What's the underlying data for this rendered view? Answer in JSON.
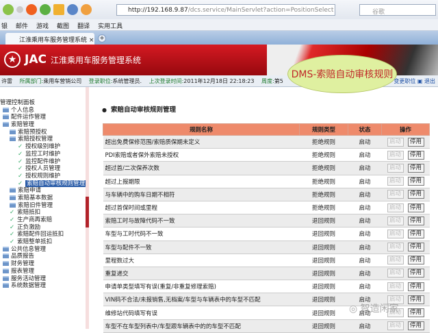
{
  "browser": {
    "url_host": "http://192.168.9.87",
    "url_path": "/dcs.service/MainServlet?action=PositionSelect",
    "search_placeholder": "谷歌",
    "bookmarks": [
      "银",
      "邮件",
      "游戏",
      "截图",
      "翻译",
      "实用工具"
    ],
    "tab_title": "江淮乘用车服务管理系统",
    "new_tab": "+"
  },
  "banner": {
    "brand": "JAC",
    "system": "江淮乘用车服务管理系统",
    "overlay": "DMS-索赔自动审核规则"
  },
  "info": {
    "user": "许雷",
    "dept_label": "所属部门:",
    "dept": "乘用车营销公司",
    "role_label": "登录职位:",
    "role": "系统管理员.",
    "last_label": "上次登录时间:",
    "last": "2011年12月18日 22:18:23",
    "week_label": "周度:",
    "week": "第5",
    "change_role": "变更职位",
    "logout": "退出"
  },
  "sidebar": {
    "title": "管理控制面板",
    "items": [
      {
        "label": "个人信息",
        "level": 0,
        "type": "folder"
      },
      {
        "label": "配件运作管理",
        "level": 0,
        "type": "folder"
      },
      {
        "label": "索赔管理",
        "level": 0,
        "type": "folder"
      },
      {
        "label": "索赔预授权",
        "level": 1,
        "type": "folder"
      },
      {
        "label": "索赔授权管理",
        "level": 1,
        "type": "folder"
      },
      {
        "label": "授权级别维护",
        "level": 2,
        "type": "leaf"
      },
      {
        "label": "监控工时维护",
        "level": 2,
        "type": "leaf"
      },
      {
        "label": "监控配件维护",
        "level": 2,
        "type": "leaf"
      },
      {
        "label": "授权人员管理",
        "level": 2,
        "type": "leaf"
      },
      {
        "label": "授权规则维护",
        "level": 2,
        "type": "leaf"
      },
      {
        "label": "索赔自动审核规则管理",
        "level": 2,
        "type": "leaf",
        "selected": true
      },
      {
        "label": "索赔申请",
        "level": 1,
        "type": "folder"
      },
      {
        "label": "索赔基本数据",
        "level": 1,
        "type": "folder"
      },
      {
        "label": "索赔旧件管理",
        "level": 1,
        "type": "folder"
      },
      {
        "label": "索赔抵扣",
        "level": 1,
        "type": "leaf"
      },
      {
        "label": "生产商再索赔",
        "level": 1,
        "type": "leaf"
      },
      {
        "label": "正负激励",
        "level": 1,
        "type": "leaf"
      },
      {
        "label": "索赔配件回运抵扣",
        "level": 1,
        "type": "leaf"
      },
      {
        "label": "索赔整单抵扣",
        "level": 1,
        "type": "leaf"
      },
      {
        "label": "公共信息管理",
        "level": 0,
        "type": "folder"
      },
      {
        "label": "品质报告",
        "level": 0,
        "type": "folder"
      },
      {
        "label": "财务管理",
        "level": 0,
        "type": "folder"
      },
      {
        "label": "报表管理",
        "level": 0,
        "type": "folder"
      },
      {
        "label": "服务活动管理",
        "level": 0,
        "type": "folder"
      },
      {
        "label": "系统数据管理",
        "level": 0,
        "type": "folder"
      }
    ]
  },
  "main": {
    "title": "索赔自动审核规则管理",
    "headers": [
      "规则名称",
      "规则类型",
      "状态",
      "操作"
    ],
    "enable_label": "启动",
    "disable_label": "停用",
    "rows": [
      {
        "name": "超出免费保修范围/索赔质保期未定义",
        "type": "拒绝规则",
        "status": "启动"
      },
      {
        "name": "PDI索赔或者保外索赔未授权",
        "type": "拒绝规则",
        "status": "启动"
      },
      {
        "name": "超过首/二次保养次数",
        "type": "拒绝规则",
        "status": "启动"
      },
      {
        "name": "超过上报期限",
        "type": "拒绝规则",
        "status": "启动"
      },
      {
        "name": "与车辆中的购车日期不相符",
        "type": "拒绝规则",
        "status": "启动"
      },
      {
        "name": "超过首保时间或里程",
        "type": "拒绝规则",
        "status": "启动"
      },
      {
        "name": "索赔工时与故障代码不一致",
        "type": "退回规则",
        "status": "启动"
      },
      {
        "name": "车型与工时代码不一致",
        "type": "退回规则",
        "status": "启动"
      },
      {
        "name": "车型与配件不一致",
        "type": "退回规则",
        "status": "启动"
      },
      {
        "name": "里程数过大",
        "type": "退回规则",
        "status": "启动"
      },
      {
        "name": "重复递交",
        "type": "退回规则",
        "status": "启动"
      },
      {
        "name": "申请单类型填写有误(重复/非重复修理索赔)",
        "type": "退回规则",
        "status": "启动"
      },
      {
        "name": "VIN码不合法/未报销售,无档案/车型与车辆表中的车型不匹配",
        "type": "退回规则",
        "status": "启动"
      },
      {
        "name": "维修站代码填写有误",
        "type": "退回规则",
        "status": "启动"
      },
      {
        "name": "车型不在车型列表中/车型跟车辆表中的的车型不匹配",
        "type": "退回规则",
        "status": "启动"
      }
    ]
  },
  "watermark": "智造闲家"
}
